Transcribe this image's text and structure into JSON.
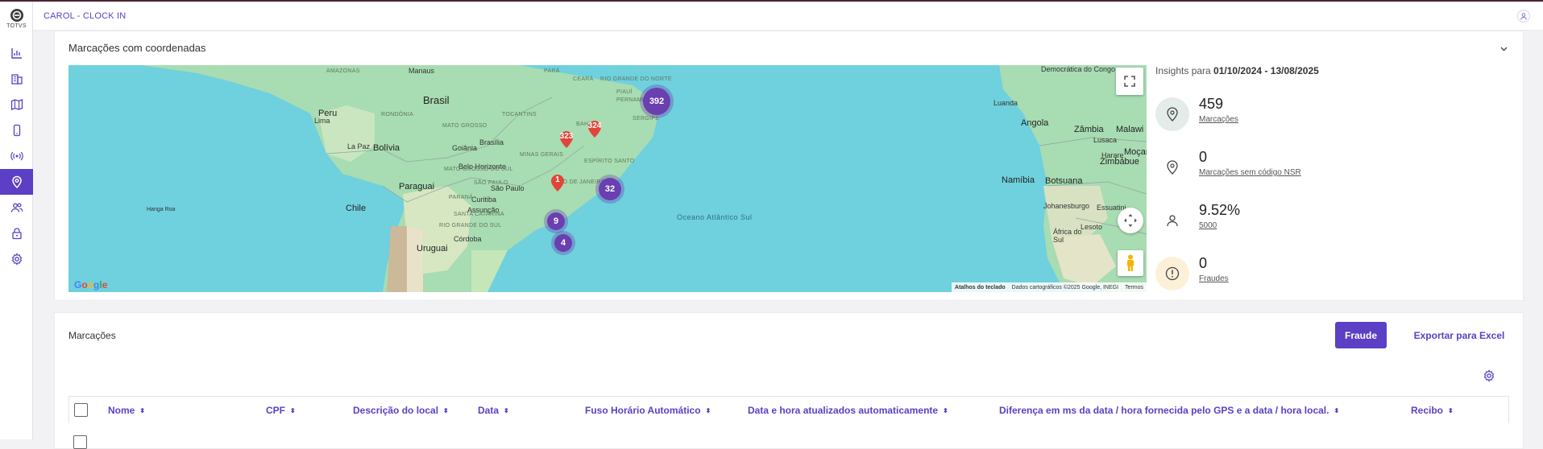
{
  "app": {
    "logo_text": "TOTVS",
    "header_title": "CAROL - CLOCK IN"
  },
  "sidebar": {
    "items": [
      {
        "icon": "bar-chart-icon",
        "active": false
      },
      {
        "icon": "building-icon",
        "active": false
      },
      {
        "icon": "map-icon",
        "active": false
      },
      {
        "icon": "mobile-icon",
        "active": false
      },
      {
        "icon": "broadcast-icon",
        "active": false
      },
      {
        "icon": "location-pin-icon",
        "active": true
      },
      {
        "icon": "users-icon",
        "active": false
      },
      {
        "icon": "lock-icon",
        "active": false
      },
      {
        "icon": "gear-icon",
        "active": false
      }
    ]
  },
  "map_card": {
    "title": "Marcações com coordenadas",
    "labels": {
      "brasil": "Brasil",
      "bolivia": "Bolívia",
      "peru": "Peru",
      "lima": "Lima",
      "paraguai": "Paraguai",
      "chile": "Chile",
      "uruguai": "Uruguai",
      "manaus": "Manaus",
      "brasilia": "Brasília",
      "goiania": "Goiânia",
      "belo_horizonte": "Belo Horizonte",
      "sao_paulo": "São Paulo",
      "curitiba": "Curitiba",
      "assuncao": "Assunção",
      "cordoba": "Córdoba",
      "la_paz": "La Paz",
      "hanga_roa": "Hanga Roa",
      "ocean": "Oceano Atlântico Sul",
      "angola": "Angola",
      "luanda": "Luanda",
      "zambia": "Zâmbia",
      "malawi": "Malawi",
      "namibia": "Namíbia",
      "botsuana": "Botsuana",
      "zimbabue": "Zimbábue",
      "harare": "Harare",
      "lusaca": "Lusaca",
      "mocambique": "Moçam",
      "johanesburgo": "Johanesburgo",
      "essuatini": "Essuatini",
      "lesoto": "Lesoto",
      "africa_do_sul": "África do Sul",
      "congo": "Democrática do Congo",
      "rondonia": "RONDÔNIA",
      "mato_grosso": "MATO GROSSO",
      "mato_grosso_do_sul": "MATO GROSSO DO SUL",
      "tocantins": "TOCANTINS",
      "bahia": "BAHIA",
      "minas_gerais": "MINAS GERAIS",
      "sao_paulo_state": "SÃO PAULO",
      "parana": "PARANÁ",
      "espirito_santo": "ESPÍRITO SANTO",
      "rio_de_janeiro": "RIO DE JANEIRO",
      "santa_catarina": "SANTA CATARINA",
      "rio_grande_do_sul": "RIO GRANDE DO SUL",
      "ceara": "CEARÁ",
      "rio_grande_do_norte": "RIO GRANDE DO NORTE",
      "pernambuco": "PERNAMBUCO",
      "sergipe": "SERGIPE",
      "piaui": "PIAUÍ",
      "amazonas": "AMAZONAS",
      "para": "PARÁ"
    },
    "clusters": [
      {
        "count": "392"
      },
      {
        "count": "32"
      },
      {
        "count": "9"
      },
      {
        "count": "4"
      }
    ],
    "pins": [
      {
        "count": "324"
      },
      {
        "count": "323"
      },
      {
        "count": "1"
      }
    ],
    "attribution": {
      "google": "Google",
      "shortcuts": "Atalhos do teclado",
      "data": "Dados cartográficos ©2025 Google, INEGI",
      "terms": "Termos"
    }
  },
  "insights": {
    "prefix": "Insights para ",
    "period": "01/10/2024 - 13/08/2025",
    "items": [
      {
        "value": "459",
        "label": "Marcações",
        "icon": "location-pin-icon",
        "bg": "#e3ece8"
      },
      {
        "value": "0",
        "label": "Marcações sem código NSR",
        "icon": "location-pin-icon",
        "bg": "#ffffff"
      },
      {
        "value": "9.52%",
        "label": "5000",
        "icon": "person-icon",
        "bg": "#ffffff"
      },
      {
        "value": "0",
        "label": "Fraudes",
        "icon": "alert-circle-icon",
        "bg": "#fdf0d8"
      }
    ]
  },
  "table_card": {
    "title": "Marcações",
    "fraud_button": "Fraude",
    "export_button": "Exportar para Excel",
    "columns": [
      "Nome",
      "CPF",
      "Descrição do local",
      "Data",
      "Fuso Horário Automático",
      "Data e hora atualizados automaticamente",
      "Diferença em ms da data / hora fornecida pelo GPS e a data / hora local.",
      "Recibo"
    ]
  },
  "colors": {
    "accent": "#5b3fc4",
    "cluster": "#6a3fb0",
    "pin": "#e0453a",
    "ocean": "#6fd0de",
    "land": "#a8dcb2"
  }
}
